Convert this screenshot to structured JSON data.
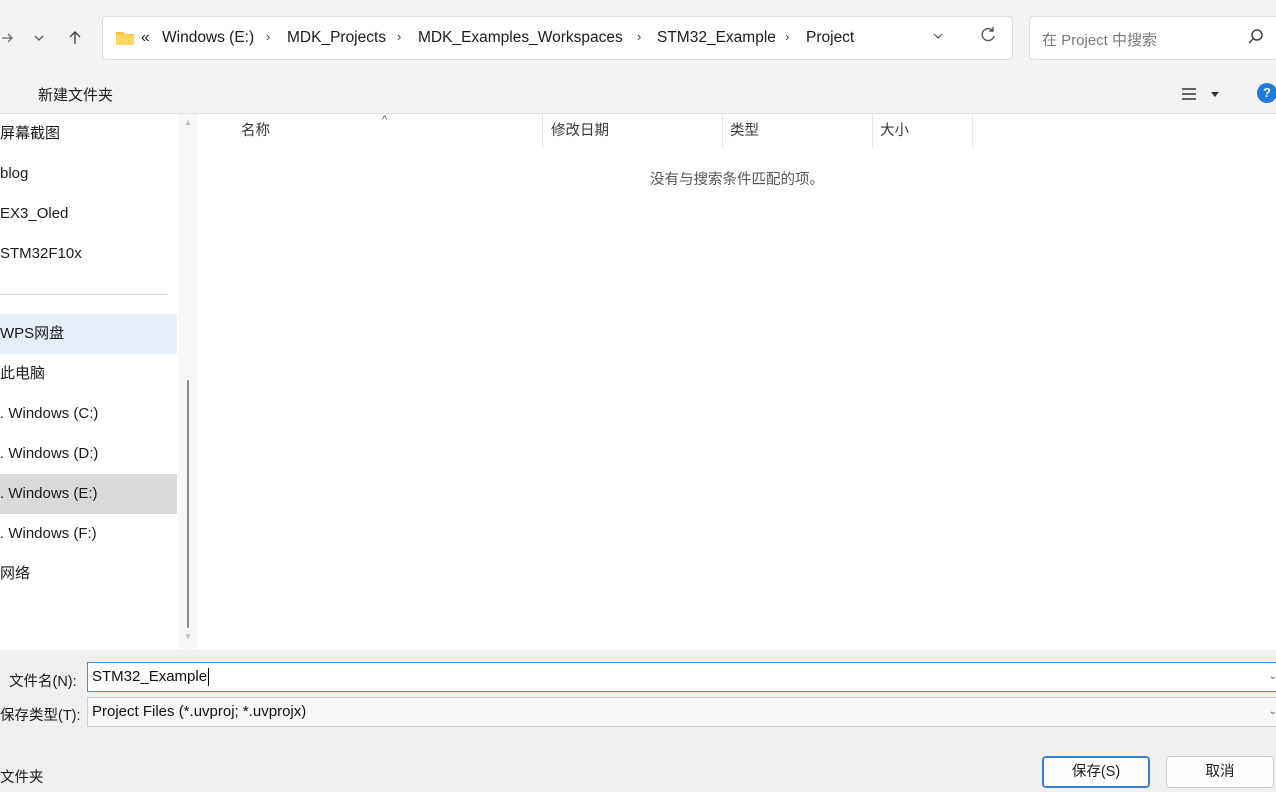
{
  "address": {
    "crumbs": [
      "Windows (E:)",
      "MDK_Projects",
      "MDK_Examples_Workspaces",
      "STM32_Example",
      "Project"
    ],
    "overflow": "«"
  },
  "search": {
    "placeholder": "在 Project 中搜索"
  },
  "toolbar": {
    "new_folder": "新建文件夹",
    "help": "?"
  },
  "sidebar": {
    "items": [
      "屏幕截图",
      "blog",
      "EX3_Oled",
      "STM32F10x",
      "WPS网盘",
      "此电脑",
      "Windows (C:)",
      "Windows (D:)",
      "Windows (E:)",
      "Windows (F:)",
      "网络"
    ],
    "hovered": "WPS网盘",
    "selected": "Windows (E:)"
  },
  "filelist": {
    "columns": [
      "名称",
      "修改日期",
      "类型",
      "大小"
    ],
    "empty_message": "没有与搜索条件匹配的项。"
  },
  "form": {
    "filename_label": "文件名(N):",
    "filename_value": "STM32_Example",
    "filetype_label": "保存类型(T):",
    "filetype_value": "Project Files (*.uvproj; *.uvprojx)",
    "folders_toggle": "文件夹"
  },
  "buttons": {
    "save": "保存(S)",
    "cancel": "取消"
  }
}
